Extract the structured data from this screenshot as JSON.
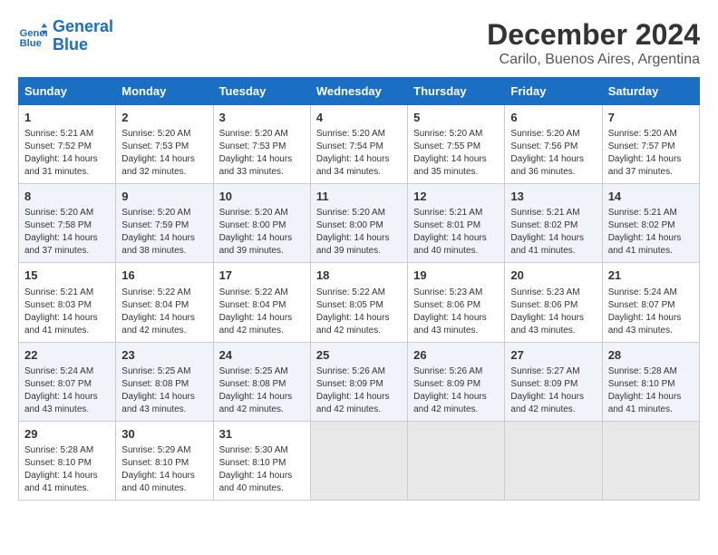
{
  "logo": {
    "line1": "General",
    "line2": "Blue"
  },
  "title": "December 2024",
  "subtitle": "Carilo, Buenos Aires, Argentina",
  "days_of_week": [
    "Sunday",
    "Monday",
    "Tuesday",
    "Wednesday",
    "Thursday",
    "Friday",
    "Saturday"
  ],
  "weeks": [
    [
      {
        "day": "1",
        "info": "Sunrise: 5:21 AM\nSunset: 7:52 PM\nDaylight: 14 hours\nand 31 minutes."
      },
      {
        "day": "2",
        "info": "Sunrise: 5:20 AM\nSunset: 7:53 PM\nDaylight: 14 hours\nand 32 minutes."
      },
      {
        "day": "3",
        "info": "Sunrise: 5:20 AM\nSunset: 7:53 PM\nDaylight: 14 hours\nand 33 minutes."
      },
      {
        "day": "4",
        "info": "Sunrise: 5:20 AM\nSunset: 7:54 PM\nDaylight: 14 hours\nand 34 minutes."
      },
      {
        "day": "5",
        "info": "Sunrise: 5:20 AM\nSunset: 7:55 PM\nDaylight: 14 hours\nand 35 minutes."
      },
      {
        "day": "6",
        "info": "Sunrise: 5:20 AM\nSunset: 7:56 PM\nDaylight: 14 hours\nand 36 minutes."
      },
      {
        "day": "7",
        "info": "Sunrise: 5:20 AM\nSunset: 7:57 PM\nDaylight: 14 hours\nand 37 minutes."
      }
    ],
    [
      {
        "day": "8",
        "info": "Sunrise: 5:20 AM\nSunset: 7:58 PM\nDaylight: 14 hours\nand 37 minutes."
      },
      {
        "day": "9",
        "info": "Sunrise: 5:20 AM\nSunset: 7:59 PM\nDaylight: 14 hours\nand 38 minutes."
      },
      {
        "day": "10",
        "info": "Sunrise: 5:20 AM\nSunset: 8:00 PM\nDaylight: 14 hours\nand 39 minutes."
      },
      {
        "day": "11",
        "info": "Sunrise: 5:20 AM\nSunset: 8:00 PM\nDaylight: 14 hours\nand 39 minutes."
      },
      {
        "day": "12",
        "info": "Sunrise: 5:21 AM\nSunset: 8:01 PM\nDaylight: 14 hours\nand 40 minutes."
      },
      {
        "day": "13",
        "info": "Sunrise: 5:21 AM\nSunset: 8:02 PM\nDaylight: 14 hours\nand 41 minutes."
      },
      {
        "day": "14",
        "info": "Sunrise: 5:21 AM\nSunset: 8:02 PM\nDaylight: 14 hours\nand 41 minutes."
      }
    ],
    [
      {
        "day": "15",
        "info": "Sunrise: 5:21 AM\nSunset: 8:03 PM\nDaylight: 14 hours\nand 41 minutes."
      },
      {
        "day": "16",
        "info": "Sunrise: 5:22 AM\nSunset: 8:04 PM\nDaylight: 14 hours\nand 42 minutes."
      },
      {
        "day": "17",
        "info": "Sunrise: 5:22 AM\nSunset: 8:04 PM\nDaylight: 14 hours\nand 42 minutes."
      },
      {
        "day": "18",
        "info": "Sunrise: 5:22 AM\nSunset: 8:05 PM\nDaylight: 14 hours\nand 42 minutes."
      },
      {
        "day": "19",
        "info": "Sunrise: 5:23 AM\nSunset: 8:06 PM\nDaylight: 14 hours\nand 43 minutes."
      },
      {
        "day": "20",
        "info": "Sunrise: 5:23 AM\nSunset: 8:06 PM\nDaylight: 14 hours\nand 43 minutes."
      },
      {
        "day": "21",
        "info": "Sunrise: 5:24 AM\nSunset: 8:07 PM\nDaylight: 14 hours\nand 43 minutes."
      }
    ],
    [
      {
        "day": "22",
        "info": "Sunrise: 5:24 AM\nSunset: 8:07 PM\nDaylight: 14 hours\nand 43 minutes."
      },
      {
        "day": "23",
        "info": "Sunrise: 5:25 AM\nSunset: 8:08 PM\nDaylight: 14 hours\nand 43 minutes."
      },
      {
        "day": "24",
        "info": "Sunrise: 5:25 AM\nSunset: 8:08 PM\nDaylight: 14 hours\nand 42 minutes."
      },
      {
        "day": "25",
        "info": "Sunrise: 5:26 AM\nSunset: 8:09 PM\nDaylight: 14 hours\nand 42 minutes."
      },
      {
        "day": "26",
        "info": "Sunrise: 5:26 AM\nSunset: 8:09 PM\nDaylight: 14 hours\nand 42 minutes."
      },
      {
        "day": "27",
        "info": "Sunrise: 5:27 AM\nSunset: 8:09 PM\nDaylight: 14 hours\nand 42 minutes."
      },
      {
        "day": "28",
        "info": "Sunrise: 5:28 AM\nSunset: 8:10 PM\nDaylight: 14 hours\nand 41 minutes."
      }
    ],
    [
      {
        "day": "29",
        "info": "Sunrise: 5:28 AM\nSunset: 8:10 PM\nDaylight: 14 hours\nand 41 minutes."
      },
      {
        "day": "30",
        "info": "Sunrise: 5:29 AM\nSunset: 8:10 PM\nDaylight: 14 hours\nand 40 minutes."
      },
      {
        "day": "31",
        "info": "Sunrise: 5:30 AM\nSunset: 8:10 PM\nDaylight: 14 hours\nand 40 minutes."
      },
      null,
      null,
      null,
      null
    ]
  ]
}
